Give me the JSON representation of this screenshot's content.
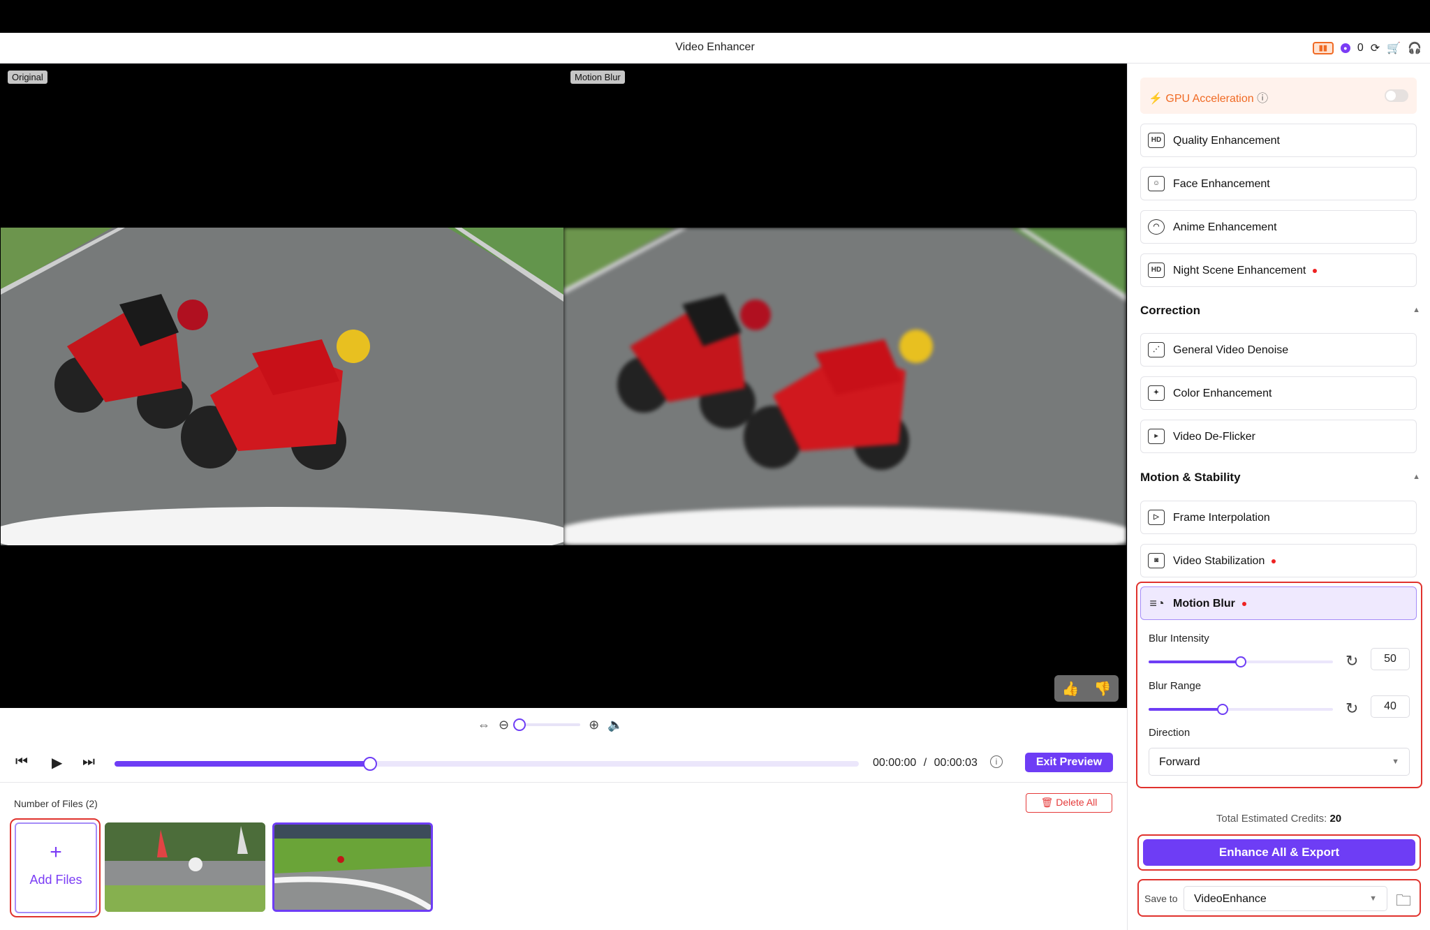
{
  "window": {
    "title": "Video Enhancer",
    "credits_count": "0"
  },
  "preview": {
    "left_label": "Original",
    "right_label": "Motion Blur"
  },
  "playback": {
    "progress": 0.343,
    "current_time": "00:00:00",
    "separator": "/",
    "total_time": "00:00:03",
    "exit_label": "Exit Preview"
  },
  "zoom": {
    "level": 0.0
  },
  "files": {
    "count_label": "Number of Files (2)",
    "delete_all_label": "Delete All",
    "add_files_label": "Add Files",
    "add_plus": "+"
  },
  "sidebar": {
    "gpu_label": "GPU Acceleration",
    "gpu_enabled": false,
    "enhancements": [
      {
        "label": "Quality Enhancement",
        "icon": "hd-icon",
        "dot": false
      },
      {
        "label": "Face Enhancement",
        "icon": "face-scan-icon",
        "dot": false
      },
      {
        "label": "Anime Enhancement",
        "icon": "anime-icon",
        "dot": false
      },
      {
        "label": "Night Scene Enhancement",
        "icon": "night-hd-icon",
        "dot": true
      }
    ],
    "correction": {
      "title": "Correction",
      "items": [
        {
          "label": "General Video Denoise",
          "icon": "denoise-icon"
        },
        {
          "label": "Color Enhancement",
          "icon": "color-icon"
        },
        {
          "label": "Video De-Flicker",
          "icon": "deflicker-icon"
        }
      ]
    },
    "motion": {
      "title": "Motion & Stability",
      "items": [
        {
          "label": "Frame Interpolation",
          "icon": "frame-icon",
          "dot": false
        },
        {
          "label": "Video Stabilization",
          "icon": "stabilize-icon",
          "dot": true
        }
      ]
    },
    "motion_blur": {
      "label": "Motion Blur",
      "blur_intensity_label": "Blur Intensity",
      "blur_intensity": "50",
      "blur_intensity_fraction": 0.5,
      "blur_range_label": "Blur Range",
      "blur_range": "40",
      "blur_range_fraction": 0.4,
      "direction_label": "Direction",
      "direction_value": "Forward"
    },
    "total_credits_label": "Total Estimated Credits:",
    "total_credits_value": "20",
    "enhance_button": "Enhance All & Export",
    "save_to_label": "Save to",
    "save_to_value": "VideoEnhance"
  },
  "colors": {
    "accent": "#6e3df5",
    "gpu": "#f06a24",
    "highlight": "#e0322d"
  }
}
